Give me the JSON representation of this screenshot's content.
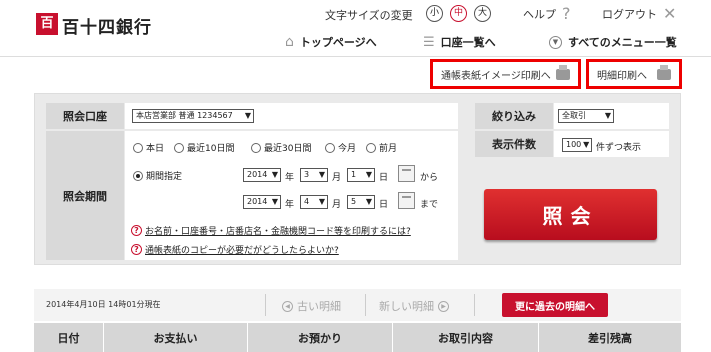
{
  "header": {
    "logo_mark": "百",
    "bank_name": "百十四銀行",
    "text_size_label": "文字サイズの変更",
    "sizes": [
      "小",
      "中",
      "大"
    ],
    "help": "ヘルプ",
    "logout": "ログアウト"
  },
  "nav": {
    "top": "トップページへ",
    "accounts": "口座一覧へ",
    "menu": "すべてのメニュー一覧"
  },
  "print": {
    "passbook_image": "通帳表紙イメージ印刷へ",
    "statement": "明細印刷へ"
  },
  "form": {
    "account_label": "照会口座",
    "account_value": "本店営業部 普通 1234567",
    "filter_label": "絞り込み",
    "filter_value": "全取引",
    "count_label": "表示件数",
    "count_value": "100",
    "count_suffix": "件ずつ表示",
    "period_label": "照会期間",
    "period_options": [
      "本日",
      "最近10日間",
      "最近30日間",
      "今月",
      "前月"
    ],
    "period_specify": "期間指定",
    "from": {
      "year": "2014",
      "month": "3",
      "day": "1"
    },
    "to": {
      "year": "2014",
      "month": "4",
      "day": "5"
    },
    "unit_year": "年",
    "unit_month": "月",
    "unit_day": "日",
    "from_suffix": "から",
    "to_suffix": "まで",
    "help1": "お名前・口座番号・店番店名・金融機関コード等を印刷するには?",
    "help2": "通帳表紙のコピーが必要だがどうしたらよいか?",
    "submit": "照会"
  },
  "results": {
    "timestamp": "2014年4月10日 14時01分現在",
    "older": "古い明細",
    "newer": "新しい明細",
    "past_button": "更に過去の明細へ",
    "columns": [
      "日付",
      "お支払い",
      "お預かり",
      "お取引内容",
      "差引残高"
    ]
  }
}
